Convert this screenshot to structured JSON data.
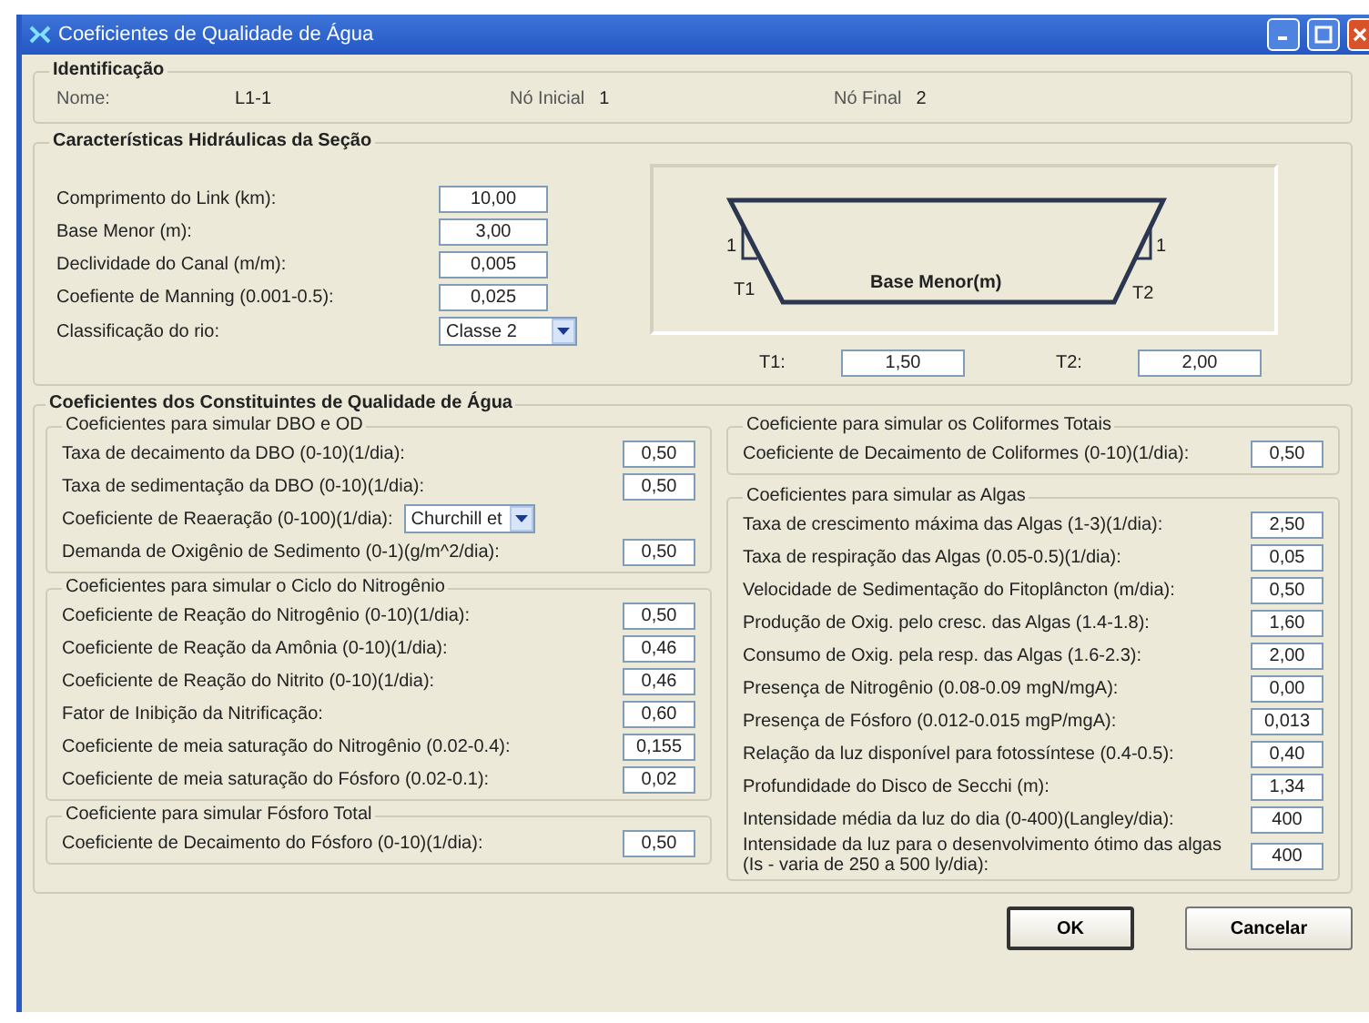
{
  "window": {
    "title": "Coeficientes de Qualidade de Água"
  },
  "identificacao": {
    "legend": "Identificação",
    "fields": [
      {
        "label": "Nome:",
        "value": "L1-1"
      },
      {
        "label": "Nó Inicial",
        "value": "1"
      },
      {
        "label": "Nó Final",
        "value": "2"
      }
    ]
  },
  "hidraulicas": {
    "legend": "Características Hidráulicas da Seção",
    "fields": [
      {
        "kind": "input",
        "label": "Comprimento do Link (km):",
        "value": "10,00"
      },
      {
        "kind": "input",
        "label": "Base Menor (m):",
        "value": "3,00"
      },
      {
        "kind": "input",
        "label": "Declividade do Canal (m/m):",
        "value": "0,005"
      },
      {
        "kind": "input",
        "label": "Coefiente de Manning (0.001-0.5):",
        "value": "0,025"
      },
      {
        "kind": "select",
        "label": "Classificação do rio:",
        "value": "Classe 2"
      }
    ],
    "diagram": {
      "base_label": "Base Menor(m)",
      "left_slope": "1",
      "left_t": "T1",
      "right_slope": "1",
      "right_t": "T2"
    },
    "t_fields": [
      {
        "label": "T1:",
        "value": "1,50"
      },
      {
        "label": "T2:",
        "value": "2,00"
      }
    ]
  },
  "constituintes": {
    "legend": "Coeficientes dos Constituintes de Qualidade de Água",
    "left_groups": [
      {
        "title": "Coeficientes para simular DBO e OD",
        "rows": [
          {
            "kind": "input",
            "label": "Taxa de decaimento da DBO (0-10)(1/dia):",
            "value": "0,50"
          },
          {
            "kind": "input",
            "label": "Taxa de sedimentação da DBO (0-10)(1/dia):",
            "value": "0,50"
          },
          {
            "kind": "select",
            "label": "Coeficiente de Reaeração (0-100)(1/dia):",
            "value": "Churchill et"
          },
          {
            "kind": "input",
            "label": "Demanda de Oxigênio de Sedimento (0-1)(g/m^2/dia):",
            "value": "0,50"
          }
        ]
      },
      {
        "title": "Coeficientes para simular o Ciclo do Nitrogênio",
        "rows": [
          {
            "kind": "input",
            "label": "Coeficiente de Reação do Nitrogênio (0-10)(1/dia):",
            "value": "0,50"
          },
          {
            "kind": "input",
            "label": "Coeficiente de Reação da Amônia (0-10)(1/dia):",
            "value": "0,46"
          },
          {
            "kind": "input",
            "label": "Coeficiente de Reação do Nitrito (0-10)(1/dia):",
            "value": "0,46"
          },
          {
            "kind": "input",
            "label": "Fator de Inibição da Nitrificação:",
            "value": "0,60"
          },
          {
            "kind": "input",
            "label": "Coeficiente de meia saturação do Nitrogênio (0.02-0.4):",
            "value": "0,155"
          },
          {
            "kind": "input",
            "label": "Coeficiente de meia saturação do Fósforo (0.02-0.1):",
            "value": "0,02"
          }
        ]
      },
      {
        "title": "Coeficiente para simular Fósforo Total",
        "rows": [
          {
            "kind": "input",
            "label": "Coeficiente de Decaimento do Fósforo (0-10)(1/dia):",
            "value": "0,50"
          }
        ]
      }
    ],
    "right_groups": [
      {
        "title": "Coeficiente para simular os Coliformes Totais",
        "rows": [
          {
            "kind": "input",
            "label": "Coeficiente de Decaimento de Coliformes (0-10)(1/dia):",
            "value": "0,50"
          }
        ]
      },
      {
        "title": "Coeficientes para simular as Algas",
        "rows": [
          {
            "kind": "input",
            "label": "Taxa de crescimento máxima das Algas (1-3)(1/dia):",
            "value": "2,50"
          },
          {
            "kind": "input",
            "label": "Taxa de respiração das Algas (0.05-0.5)(1/dia):",
            "value": "0,05"
          },
          {
            "kind": "input",
            "label": "Velocidade de Sedimentação do Fitoplâncton (m/dia):",
            "value": "0,50"
          },
          {
            "kind": "input",
            "label": "Produção de Oxig. pelo cresc. das Algas (1.4-1.8):",
            "value": "1,60"
          },
          {
            "kind": "input",
            "label": "Consumo de Oxig. pela resp. das Algas (1.6-2.3):",
            "value": "2,00"
          },
          {
            "kind": "input",
            "label": "Presença de Nitrogênio (0.08-0.09 mgN/mgA):",
            "value": "0,00"
          },
          {
            "kind": "input",
            "label": "Presença de Fósforo (0.012-0.015 mgP/mgA):",
            "value": "0,013"
          },
          {
            "kind": "input",
            "label": "Relação da luz disponível para fotossíntese (0.4-0.5):",
            "value": "0,40"
          },
          {
            "kind": "input",
            "label": "Profundidade do Disco de Secchi (m):",
            "value": "1,34"
          },
          {
            "kind": "input",
            "label": "Intensidade média da luz do dia (0-400)(Langley/dia):",
            "value": "400"
          },
          {
            "kind": "input",
            "label": "Intensidade da luz para o desenvolvimento ótimo das algas (Is - varia de 250 a 500 ly/dia):",
            "value": "400"
          }
        ]
      }
    ]
  },
  "buttons": [
    {
      "label": "OK",
      "default": true
    },
    {
      "label": "Cancelar",
      "default": false
    }
  ]
}
